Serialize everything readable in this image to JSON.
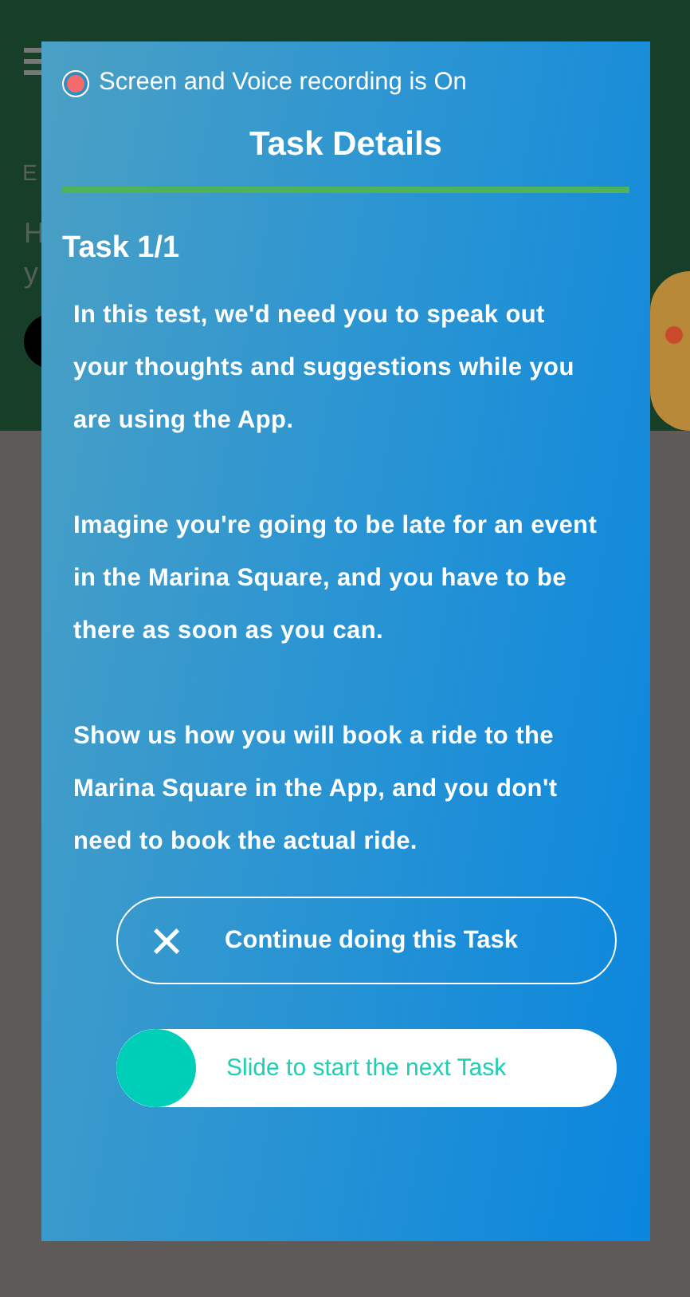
{
  "background": {
    "header_fragments": [
      "E",
      "H",
      "y"
    ]
  },
  "modal": {
    "recording": {
      "on": true,
      "label": "Screen and Voice recording is On"
    },
    "title": "Task Details",
    "task_label": "Task 1/1",
    "paragraphs": [
      "In this test, we'd need you to speak out your thoughts and suggestions while you are using the App.",
      "Imagine you're going to be late for an event in the Marina Square, and you have to be there as soon as you can.",
      "Show us how you will book a ride to the Marina Square in the App, and you don't need to book the actual ride."
    ],
    "continue_button": {
      "icon": "×",
      "label": "Continue doing this Task"
    },
    "slider": {
      "label": "Slide to start the next Task",
      "level": 0
    }
  }
}
